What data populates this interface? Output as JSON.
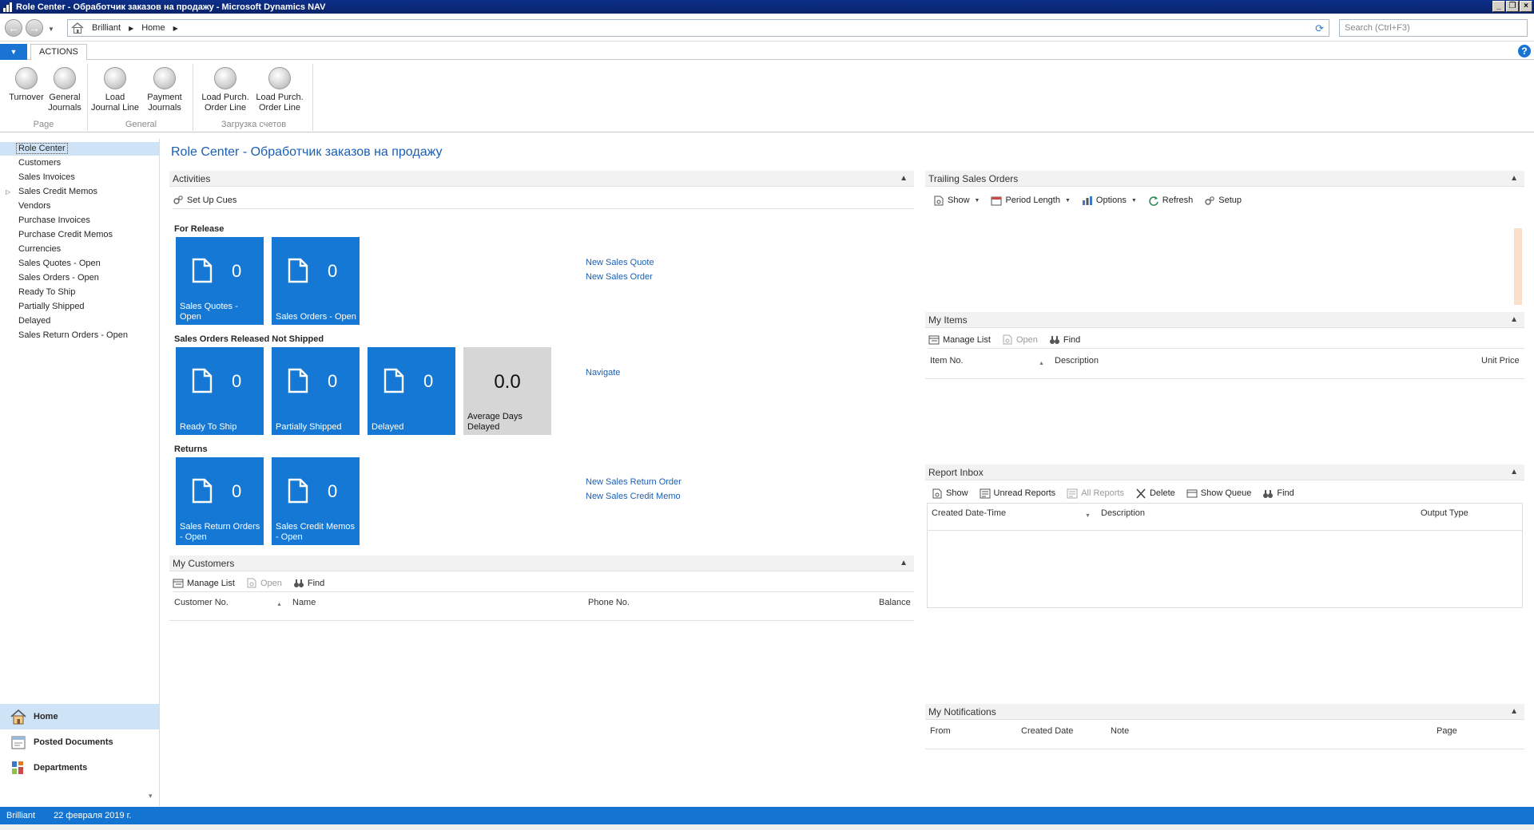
{
  "window": {
    "title": "Role Center - Обработчик заказов на продажу - Microsoft Dynamics NAV"
  },
  "address": {
    "crumbs": [
      "Brilliant",
      "Home"
    ],
    "search_placeholder": "Search (Ctrl+F3)"
  },
  "ribbon": {
    "tab": "ACTIONS",
    "groups": [
      {
        "label": "Page",
        "buttons": [
          "Turnover",
          "General\nJournals"
        ]
      },
      {
        "label": "General",
        "buttons": [
          "Load\nJournal Line",
          "Payment\nJournals"
        ]
      },
      {
        "label": "Загрузка счетов",
        "buttons": [
          "Load Purch.\nOrder Line",
          "Load Purch.\nOrder Line"
        ]
      }
    ]
  },
  "nav": {
    "items": [
      "Role Center",
      "Customers",
      "Sales Invoices",
      "Sales Credit Memos",
      "Vendors",
      "Purchase Invoices",
      "Purchase Credit Memos",
      "Currencies",
      "Sales Quotes - Open",
      "Sales Orders - Open",
      "Ready To Ship",
      "Partially Shipped",
      "Delayed",
      "Sales Return Orders - Open"
    ],
    "panes": [
      "Home",
      "Posted Documents",
      "Departments"
    ]
  },
  "page": {
    "title": "Role Center - Обработчик заказов на продажу"
  },
  "activities": {
    "header": "Activities",
    "setup_cues": "Set Up Cues",
    "for_release": {
      "label": "For Release",
      "tiles": [
        {
          "count": "0",
          "label": "Sales Quotes -\nOpen"
        },
        {
          "count": "0",
          "label": "Sales Orders - Open"
        }
      ],
      "links": [
        "New Sales Quote",
        "New Sales Order"
      ]
    },
    "released_not_shipped": {
      "label": "Sales Orders Released Not Shipped",
      "tiles": [
        {
          "count": "0",
          "label": "Ready To Ship"
        },
        {
          "count": "0",
          "label": "Partially Shipped"
        },
        {
          "count": "0",
          "label": "Delayed"
        },
        {
          "count": "0.0",
          "label": "Average Days\nDelayed"
        }
      ],
      "links": [
        "Navigate"
      ]
    },
    "returns": {
      "label": "Returns",
      "tiles": [
        {
          "count": "0",
          "label": "Sales Return Orders\n- Open"
        },
        {
          "count": "0",
          "label": "Sales Credit Memos\n- Open"
        }
      ],
      "links": [
        "New Sales Return Order",
        "New Sales Credit Memo"
      ]
    }
  },
  "my_customers": {
    "header": "My Customers",
    "toolbar": [
      "Manage List",
      "Open",
      "Find"
    ],
    "columns": [
      "Customer No.",
      "Name",
      "Phone No.",
      "Balance"
    ]
  },
  "trailing_sales": {
    "header": "Trailing Sales Orders",
    "toolbar": [
      "Show",
      "Period Length",
      "Options",
      "Refresh",
      "Setup"
    ]
  },
  "my_items": {
    "header": "My Items",
    "toolbar": [
      "Manage List",
      "Open",
      "Find"
    ],
    "columns": [
      "Item No.",
      "Description",
      "Unit Price"
    ]
  },
  "report_inbox": {
    "header": "Report Inbox",
    "toolbar": [
      "Show",
      "Unread Reports",
      "All Reports",
      "Delete",
      "Show Queue",
      "Find"
    ],
    "columns": [
      "Created Date-Time",
      "Description",
      "Output Type"
    ]
  },
  "my_notifications": {
    "header": "My Notifications",
    "columns": [
      "From",
      "Created Date",
      "Note",
      "Page"
    ]
  },
  "status": {
    "company": "Brilliant",
    "date": "22 февраля 2019 г."
  },
  "colors": {
    "accent": "#1478d4",
    "title_bar": "#0a246a",
    "link": "#1a5fb4",
    "tile_grey": "#d6d6d6"
  }
}
